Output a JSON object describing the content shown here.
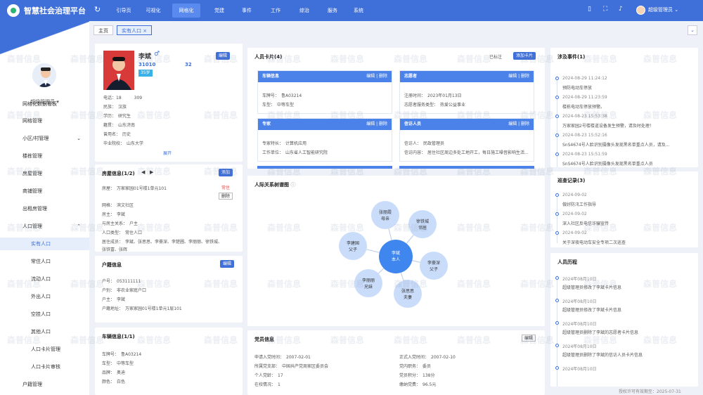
{
  "app": {
    "title": "智慧社会治理平台"
  },
  "topnav": {
    "items": [
      "引导页",
      "可视化",
      "网格化",
      "党建",
      "事件",
      "工作",
      "综治",
      "服务",
      "系统"
    ],
    "active": "网格化",
    "user": "超级管理员"
  },
  "sidebar": {
    "user": "超级管理员",
    "menu": [
      {
        "label": "网格化数据看板",
        "level": 1
      },
      {
        "label": "网格管理",
        "level": 1
      },
      {
        "label": "小区/村管理",
        "level": 1,
        "chev": "⌄"
      },
      {
        "label": "楼栋管理",
        "level": 1
      },
      {
        "label": "房屋管理",
        "level": 1
      },
      {
        "label": "商铺管理",
        "level": 1
      },
      {
        "label": "出租房管理",
        "level": 1
      },
      {
        "label": "人口管理",
        "level": 1,
        "chev": "⌃"
      },
      {
        "label": "实有人口",
        "level": 2,
        "active": true
      },
      {
        "label": "常住人口",
        "level": 2
      },
      {
        "label": "流动人口",
        "level": 2
      },
      {
        "label": "外出人口",
        "level": 2
      },
      {
        "label": "空挂人口",
        "level": 2
      },
      {
        "label": "其他人口",
        "level": 2
      },
      {
        "label": "人口卡片管理",
        "level": 2
      },
      {
        "label": "人口卡片审核",
        "level": 2
      },
      {
        "label": "户籍管理",
        "level": 1
      }
    ]
  },
  "tabs": [
    {
      "label": "主页",
      "active": false
    },
    {
      "label": "实有人口",
      "active": true,
      "close": "×"
    }
  ],
  "profile": {
    "name": "李斌",
    "gender_icon": "♂",
    "edit": "编辑",
    "id_part1": "31010",
    "id_part2": "32",
    "age_badge": "35岁",
    "phone": "电话：18　　　309",
    "nation": "民族：　汉族",
    "education": "学历：　研究生",
    "origin": "籍贯：　山东济南",
    "major": "曾用名：　历史",
    "school": "毕业院校：　山东大学",
    "expand": "展开"
  },
  "house": {
    "title": "房屋信息(1/2)",
    "add": "添加",
    "address": "房屋：　万家家园01号楼1单元101",
    "status": "常住",
    "delete": "删除",
    "grid": "网格：　滨文社区",
    "owner": "房主：　李斌",
    "relation": "与房主关系：　户主",
    "type": "人口类型：　常住人口",
    "members": "居住成员：　李斌、张思思、李豪深、李楚圃、李丽丽、徐铁城、",
    "members2": "张铁富、张辉"
  },
  "household": {
    "title": "户籍信息",
    "edit": "编辑",
    "huhao": "户号：　053111111",
    "hutype": "户别：　非农业家庭户口",
    "head": "户主：　李斌",
    "addr": "户籍地址：　万家家园01号楼1单元1层101"
  },
  "vehicle": {
    "title": "车辆信息(1/1)",
    "plate": "车牌号：　鲁A03214",
    "type": "车型：　中等车型",
    "brand": "品牌：　奥迪",
    "color": "颜色：　白色"
  },
  "personcards": {
    "title": "人员卡片(4)",
    "status": "已标注",
    "add": "添加卡片",
    "cards": [
      {
        "head": "车辆信息",
        "acts": "编辑 | 删除",
        "l1": "车牌号：　鲁A03214",
        "l2": "车型：　中等车型"
      },
      {
        "head": "志愿者",
        "acts": "编辑 | 删除",
        "l1": "注册时间：　2023年01月13日",
        "l2": "志愿者服务类型：　热爱公益事业"
      },
      {
        "head": "专家",
        "acts": "编辑 | 删除",
        "l1": "专家特长：　计算机应用",
        "l2": "工作单位：　山东省人工智能研究院"
      },
      {
        "head": "信访人员",
        "acts": "编辑 | 删除",
        "l1": "信访人：　民政管理员",
        "l2": "信访内容：　居住社区周边多处工地开工，每日施工噪音影响生活..."
      }
    ]
  },
  "relations": {
    "title": "人际关系树谱图",
    "center": {
      "name": "李斌",
      "role": "本人"
    },
    "nodes": [
      {
        "name": "张丽霞",
        "role": "母亲"
      },
      {
        "name": "徐铁城",
        "role": "邻居"
      },
      {
        "name": "李建国",
        "role": "父子"
      },
      {
        "name": "李豪深",
        "role": "父子"
      },
      {
        "name": "李丽丽",
        "role": "兄妹"
      },
      {
        "name": "张思思",
        "role": "夫妻"
      }
    ]
  },
  "party": {
    "title": "党员信息",
    "edit": "编辑",
    "rows": [
      [
        "申请入党时间：　2007-02-01",
        "正式入党时间：　2007-02-10"
      ],
      [
        "所属党支部：　中国共产党周家区委员会",
        "党内职务：　委员"
      ],
      [
        "个人党龄：　17",
        "党员积分：　138分"
      ],
      [
        "在校情况：　1",
        "缴纳党费：　96.5元"
      ]
    ]
  },
  "events": {
    "title": "涉及事件(1)",
    "items": [
      {
        "time": "2024-08-29 11:24:12",
        "text": "预防电动车停放"
      },
      {
        "time": "2024-08-29 11:23:59",
        "text": "楼栋电动车停放预警。"
      },
      {
        "time": "2024-08-23 15:53:38",
        "text": "万家家园2号楼楼道设备发生预警，请及时处理！"
      },
      {
        "time": "2024-08-23 15:52:16",
        "text": "SnS4674号人脸识别摄像头发现黑名单重点人员，请及..."
      },
      {
        "time": "2024-08-23 15:51:59",
        "text": "SnS4674号人脸识别摄像头发现黑名单重点人员"
      }
    ]
  },
  "visits": {
    "title": "巡查记录(3)",
    "items": [
      {
        "time": "2024-09-02",
        "text": "做好防汛工作指导"
      },
      {
        "time": "2024-09-02",
        "text": "深入社区反电信诈骗宣传"
      },
      {
        "time": "2024-09-02",
        "text": "关于深夜电动车安全专项二次巡查"
      }
    ]
  },
  "history": {
    "title": "人员历程",
    "items": [
      {
        "time": "2024年08月10日",
        "text": "超级管理员修改了李斌卡片信息"
      },
      {
        "time": "2024年08月10日",
        "text": "超级管理员修改了李斌卡片信息"
      },
      {
        "time": "2024年08月10日",
        "text": "超级管理员删除了李斌的志愿者卡片信息"
      },
      {
        "time": "2024年08月10日",
        "text": "超级管理员删除了李斌的信访人员卡片信息"
      },
      {
        "time": "2024年08月10日",
        "text": ""
      }
    ]
  },
  "footer": {
    "license": "授权许可有效期至：2025-07-31"
  },
  "watermark": "森普信息",
  "colors": {
    "primary": "#3f6fd8",
    "accent": "#2bb673",
    "danger": "#e04b4b"
  }
}
